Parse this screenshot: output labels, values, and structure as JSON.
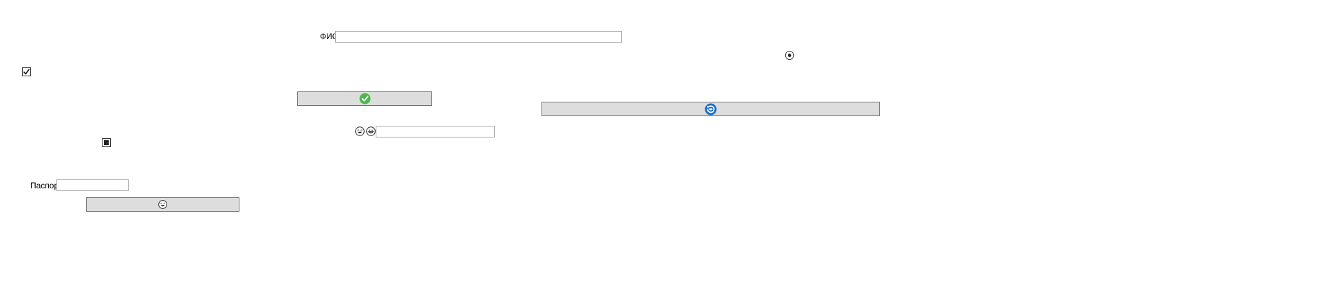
{
  "form": {
    "fio_label": "ФИО",
    "fio_value": "",
    "passport_label": "Паспорт",
    "passport_value": "",
    "emoji_field_value": "",
    "radio_selected": true,
    "checkbox_checked": true,
    "checkbox_indeterminate": true
  },
  "icons": {
    "confirm_button_icon": "check-circle-icon",
    "refresh_button_icon": "refresh-icon",
    "bottom_button_icon": "laughing-face-icon",
    "field_icon_1": "laughing-face-icon",
    "field_icon_2": "grinning-face-icon"
  },
  "colors": {
    "check_green": "#4cb84c",
    "refresh_blue": "#1e6fc9",
    "button_bg": "#dddddd",
    "button_border": "#707070",
    "input_border": "#a8a8a8"
  }
}
